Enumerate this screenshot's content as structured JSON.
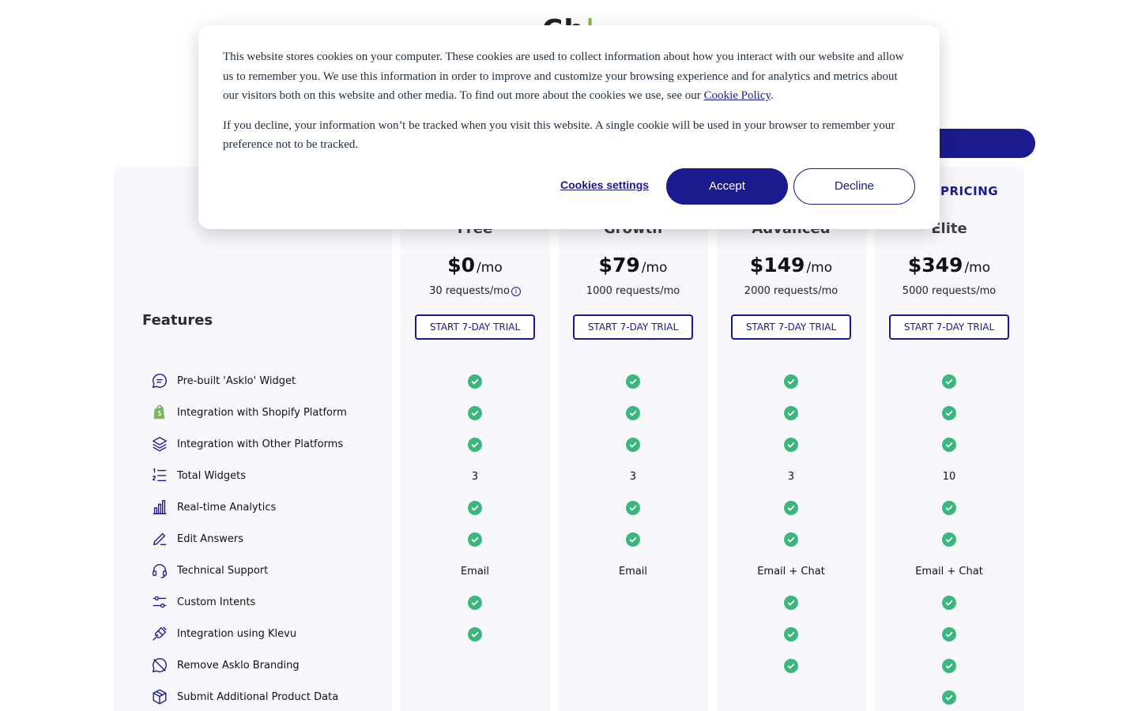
{
  "page": {
    "title_left": "Ch",
    "title_accent": "|",
    "pricing_tag": "PRICING"
  },
  "colors": {
    "brand": "#1b1a8e",
    "check": "#3bb77e",
    "column_bg": "#f7f7fc",
    "shopify": "#7ab55c"
  },
  "plans": [
    {
      "name": "Free",
      "price": "$0",
      "per": "/mo",
      "requests": "30 requests/mo",
      "has_info": true,
      "cta": "START 7-DAY TRIAL"
    },
    {
      "name": "Growth",
      "price": "$79",
      "per": "/mo",
      "requests": "1000 requests/mo",
      "has_info": false,
      "cta": "START 7-DAY TRIAL"
    },
    {
      "name": "Advanced",
      "price": "$149",
      "per": "/mo",
      "requests": "2000 requests/mo",
      "has_info": false,
      "cta": "START 7-DAY TRIAL"
    },
    {
      "name": "Elite",
      "price": "$349",
      "per": "/mo",
      "requests": "5000 requests/mo",
      "has_info": false,
      "cta": "START 7-DAY TRIAL"
    }
  ],
  "features_heading": "Features",
  "features": [
    {
      "label": "Pre-built 'Asklo' Widget",
      "icon": "chat-bubble-icon",
      "values": [
        "check",
        "check",
        "check",
        "check"
      ]
    },
    {
      "label": "Integration with Shopify Platform",
      "icon": "shopify-bag-icon",
      "values": [
        "check",
        "check",
        "check",
        "check"
      ]
    },
    {
      "label": "Integration with Other Platforms",
      "icon": "layers-icon",
      "values": [
        "check",
        "check",
        "check",
        "check"
      ]
    },
    {
      "label": "Total Widgets",
      "icon": "numbered-list-icon",
      "values": [
        "3",
        "3",
        "3",
        "10"
      ]
    },
    {
      "label": "Real-time Analytics",
      "icon": "bar-chart-icon",
      "values": [
        "check",
        "check",
        "check",
        "check"
      ]
    },
    {
      "label": "Edit Answers",
      "icon": "pencil-icon",
      "values": [
        "check",
        "check",
        "check",
        "check"
      ]
    },
    {
      "label": "Technical Support",
      "icon": "headset-icon",
      "values": [
        "Email",
        "Email",
        "Email + Chat",
        "Email + Chat"
      ]
    },
    {
      "label": "Custom Intents",
      "icon": "sliders-icon",
      "values": [
        "check",
        "",
        "check",
        "check"
      ]
    },
    {
      "label": "Integration using Klevu",
      "icon": "plug-icon",
      "values": [
        "check",
        "",
        "check",
        "check"
      ]
    },
    {
      "label": "Remove Asklo Branding",
      "icon": "chat-off-icon",
      "values": [
        "",
        "",
        "check",
        "check"
      ]
    },
    {
      "label": "Submit Additional Product Data",
      "icon": "package-icon",
      "values": [
        "",
        "",
        "",
        "check"
      ]
    }
  ],
  "cookie": {
    "p1_before": "This website stores cookies on your computer. These cookies are used to collect information about how you interact with our website and allow us to remember you. We use this information in order to improve and customize your browsing experience and for analytics and metrics about our visitors both on this website and other media. To find out more about the cookies we use, see our ",
    "p1_link": "Cookie Policy",
    "p1_after": ".",
    "p2": "If you decline, your information won’t be tracked when you visit this website. A single cookie will be used in your browser to remember your preference not to be tracked.",
    "settings": "Cookies settings",
    "accept": "Accept",
    "decline": "Decline"
  }
}
